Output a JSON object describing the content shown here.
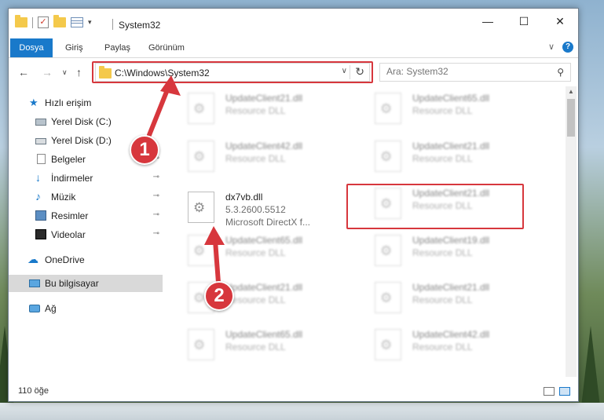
{
  "window": {
    "title": "System32",
    "controls": {
      "minimize": "—",
      "maximize": "☐",
      "close": "✕"
    }
  },
  "ribbon": {
    "tabs": [
      "Dosya",
      "Giriş",
      "Paylaş",
      "Görünüm"
    ],
    "expand_glyph": "∨",
    "help_glyph": "?"
  },
  "address_bar": {
    "path": "C:\\Windows\\System32",
    "dropdown_glyph": "∨",
    "refresh_glyph": "↻"
  },
  "search": {
    "placeholder": "Ara: System32",
    "icon": "search-icon"
  },
  "nav": {
    "back": "←",
    "forward": "→",
    "recent": "∨",
    "up": "↑"
  },
  "sidebar": {
    "items": [
      {
        "label": "Hızlı erişim",
        "icon": "star-icon"
      },
      {
        "label": "Yerel Disk (C:)",
        "icon": "disk-icon"
      },
      {
        "label": "Yerel Disk (D:)",
        "icon": "disk-icon"
      },
      {
        "label": "Belgeler",
        "icon": "document-icon"
      },
      {
        "label": "İndirmeler",
        "icon": "download-icon"
      },
      {
        "label": "Müzik",
        "icon": "music-icon"
      },
      {
        "label": "Resimler",
        "icon": "pictures-icon"
      },
      {
        "label": "Videolar",
        "icon": "video-icon"
      },
      {
        "label": "OneDrive",
        "icon": "cloud-icon"
      },
      {
        "label": "Bu bilgisayar",
        "icon": "computer-icon",
        "selected": true
      },
      {
        "label": "Ağ",
        "icon": "network-icon"
      }
    ],
    "pin_glyph": "📌"
  },
  "files": {
    "left_column": [
      {
        "name": "UpdateClient21.dll",
        "type": "Resource DLL"
      },
      {
        "name": "UpdateClient42.dll",
        "type": "Resource DLL"
      },
      {
        "name": "dx7vb.dll",
        "version": "5.3.2600.5512",
        "description": "Microsoft DirectX f...",
        "selected": true
      },
      {
        "name": "UpdateClient65.dll",
        "type": "Resource DLL"
      },
      {
        "name": "UpdateClient21.dll",
        "type": "Resource DLL"
      },
      {
        "name": "UpdateClient65.dll",
        "type": "Resource DLL"
      }
    ],
    "right_column": [
      {
        "name": "UpdateClient65.dll",
        "type": "Resource DLL"
      },
      {
        "name": "UpdateClient21.dll",
        "type": "Resource DLL"
      },
      {
        "name": "UpdateClient21.dll",
        "type": "Resource DLL"
      },
      {
        "name": "UpdateClient19.dll",
        "type": "Resource DLL"
      },
      {
        "name": "UpdateClient21.dll",
        "type": "Resource DLL"
      },
      {
        "name": "UpdateClient42.dll",
        "type": "Resource DLL"
      }
    ]
  },
  "status": {
    "item_count": "110 öğe"
  },
  "callouts": [
    "1",
    "2"
  ],
  "colors": {
    "accent": "#1979ca",
    "highlight": "#d7373d",
    "selected_bg": "#d9d9d9"
  }
}
